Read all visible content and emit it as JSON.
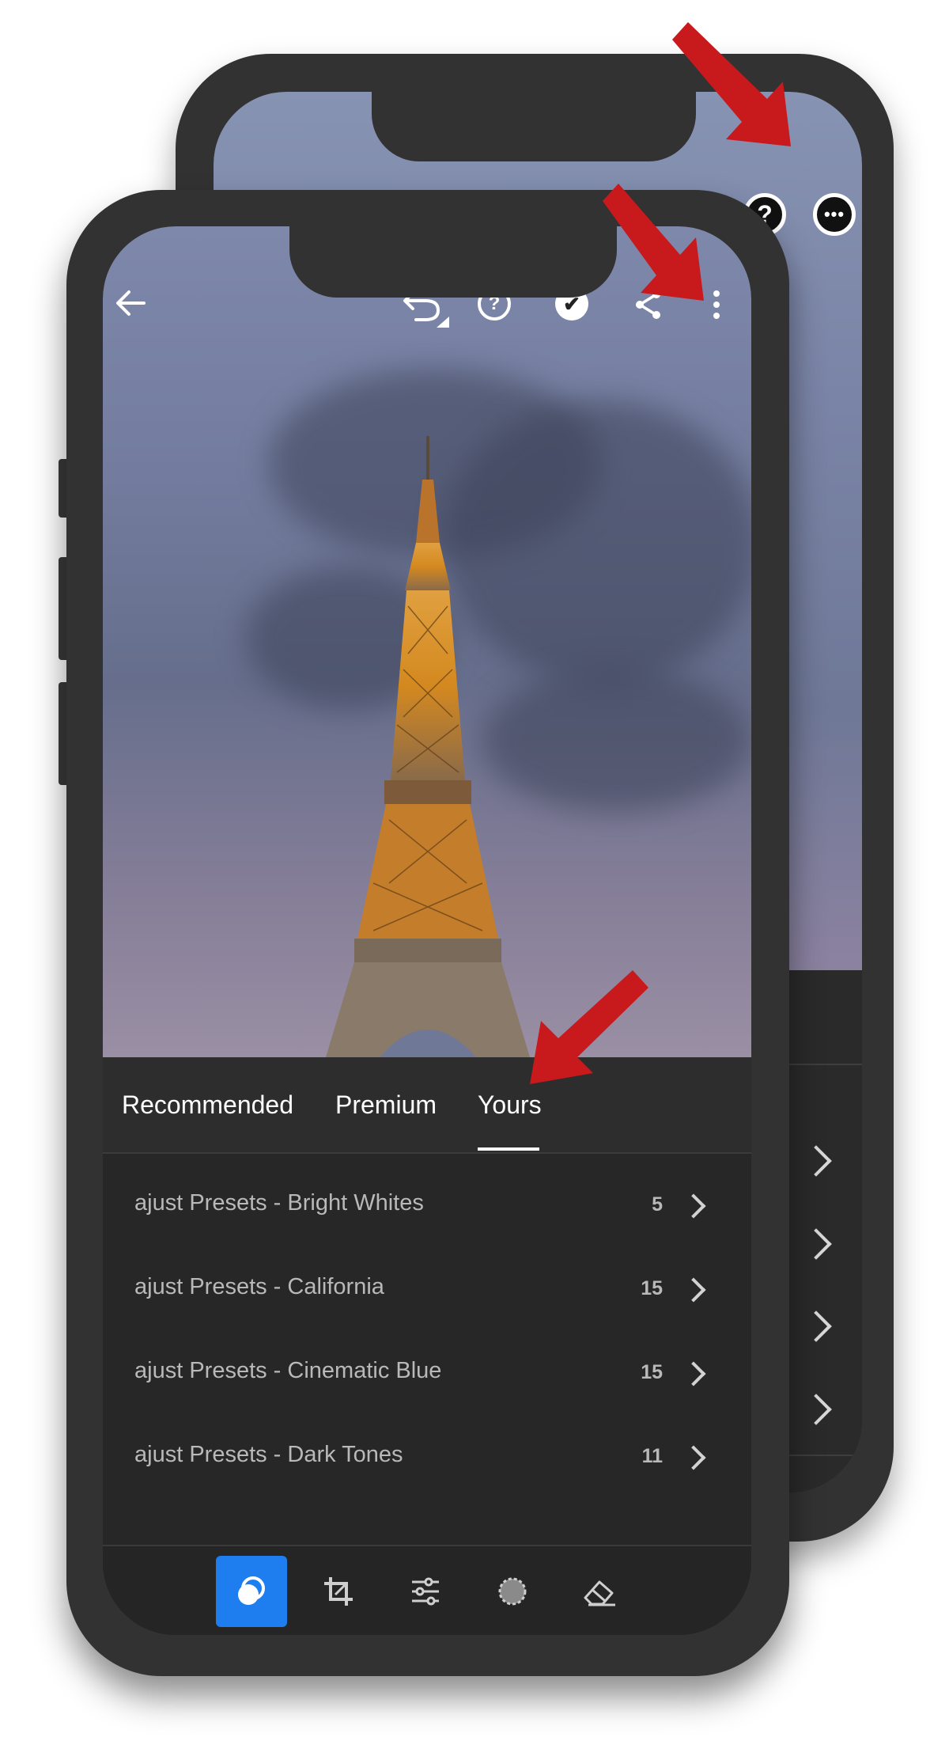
{
  "toolbar": {
    "icons": [
      "back-arrow-icon",
      "undo-icon",
      "help-icon",
      "check-icon",
      "share-icon",
      "more-vertical-icon"
    ]
  },
  "back_toolbar": {
    "icons": [
      "back-arrow-icon",
      "help-icon",
      "more-horizontal-icon"
    ]
  },
  "presets": {
    "tabs": [
      {
        "label": "Recommended"
      },
      {
        "label": "Premium"
      },
      {
        "label": "Yours",
        "selected": true
      }
    ],
    "items": [
      {
        "name": "ajust Presets - Bright Whites",
        "count": "5"
      },
      {
        "name": "ajust Presets - California",
        "count": "15"
      },
      {
        "name": "ajust Presets - Cinematic Blue",
        "count": "15"
      },
      {
        "name": "ajust Presets - Dark Tones",
        "count": "11"
      }
    ]
  },
  "bottom_tools": [
    {
      "icon": "presets-icon",
      "active": true
    },
    {
      "icon": "crop-icon",
      "active": false
    },
    {
      "icon": "adjust-sliders-icon",
      "active": false
    },
    {
      "icon": "selective-icon",
      "active": false
    },
    {
      "icon": "eraser-icon",
      "active": false
    }
  ],
  "colors": {
    "accent": "#1e7ef0",
    "annotation_arrow": "#c8191d",
    "panel_bg": "#272727",
    "frame": "#323232"
  }
}
